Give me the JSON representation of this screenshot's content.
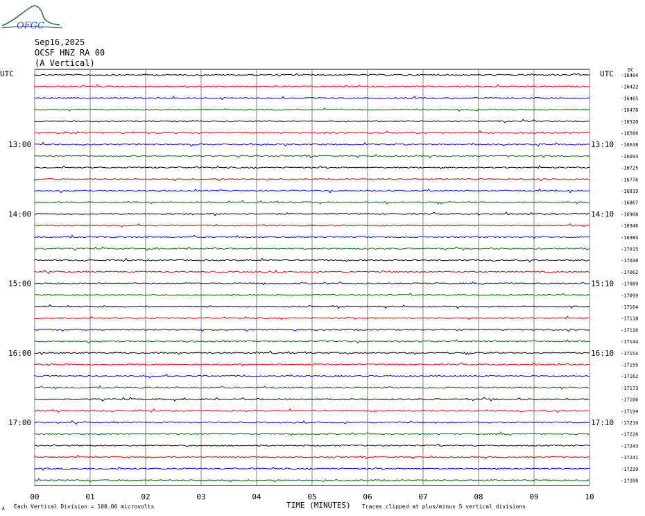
{
  "header": {
    "logo_text": "OFGC",
    "date": "Sep16,2025",
    "station": "OCSF HNZ RA 00",
    "component": "(A Vertical)"
  },
  "chart_data": {
    "type": "line",
    "title": "",
    "left_timezone": "UTC",
    "right_timezone": "UTC",
    "right_column_header": "DC",
    "xlabel": "TIME (MINUTES)",
    "xlim": [
      0,
      10
    ],
    "x_ticks": [
      "00",
      "01",
      "02",
      "03",
      "04",
      "05",
      "06",
      "07",
      "08",
      "09",
      "10"
    ],
    "left_hour_labels": [
      {
        "row": 6,
        "label": "13:00"
      },
      {
        "row": 12,
        "label": "14:00"
      },
      {
        "row": 18,
        "label": "15:00"
      },
      {
        "row": 24,
        "label": "16:00"
      },
      {
        "row": 30,
        "label": "17:00"
      }
    ],
    "right_hour_labels": [
      {
        "row": 6,
        "label": "13:10"
      },
      {
        "row": 12,
        "label": "14:10"
      },
      {
        "row": 18,
        "label": "15:10"
      },
      {
        "row": 24,
        "label": "16:10"
      },
      {
        "row": 30,
        "label": "17:10"
      }
    ],
    "trace_colors": [
      "#000000",
      "#dd0000",
      "#0000cc",
      "#006600"
    ],
    "dc_offsets": [
      -16404,
      -16422,
      -16465,
      -16478,
      -16520,
      -16586,
      -16638,
      -16693,
      -16725,
      -16776,
      -16819,
      -16867,
      -16908,
      -16946,
      -16984,
      -17015,
      -17038,
      -17062,
      -17089,
      -17099,
      -17104,
      -17118,
      -17126,
      -17144,
      -17154,
      -17155,
      -17162,
      -17173,
      -17186,
      -17194,
      -17210,
      -17226,
      -17243,
      -17241,
      -17229,
      -17200
    ],
    "footer_left": "Each Vertical Division =  100.00 microvolts",
    "footer_right": "Traces clipped at plus/minus 5 vertical divisions",
    "footer_mark": "A"
  }
}
